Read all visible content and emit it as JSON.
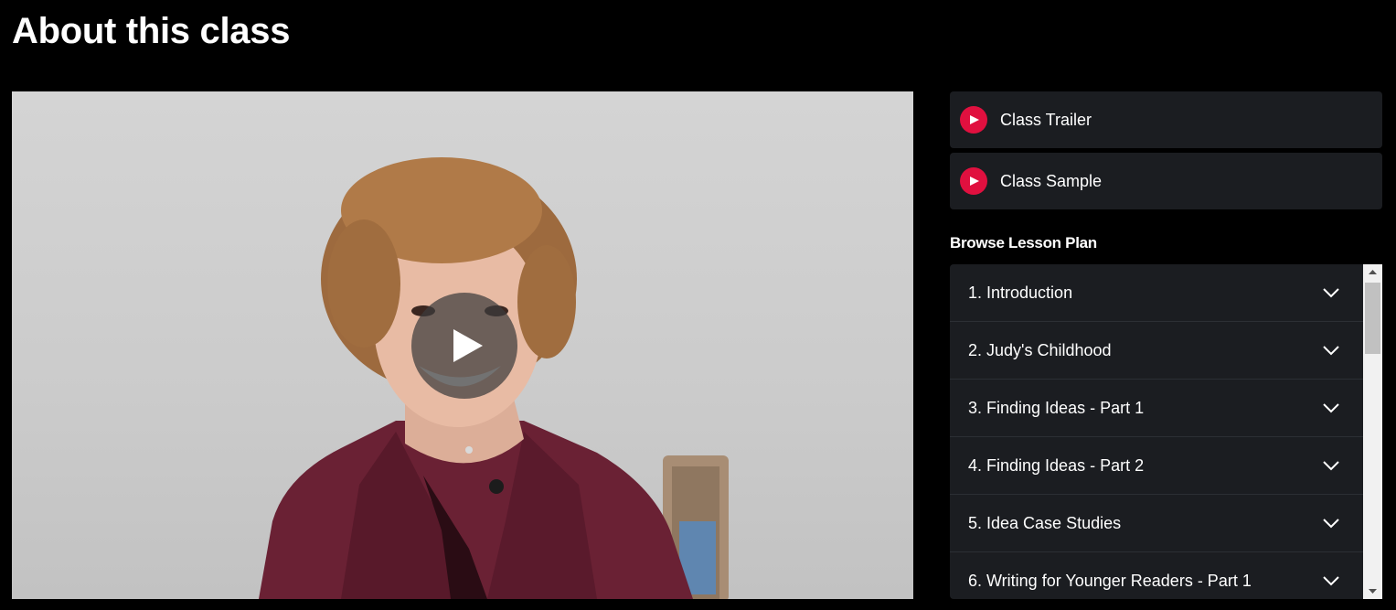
{
  "page": {
    "title": "About this class"
  },
  "video": {
    "poster_alt": "Instructor portrait",
    "play_icon": "play-icon"
  },
  "media": [
    {
      "label": "Class Trailer",
      "icon": "play-icon"
    },
    {
      "label": "Class Sample",
      "icon": "play-icon"
    }
  ],
  "lesson_plan": {
    "heading": "Browse Lesson Plan",
    "lessons": [
      {
        "title": "1. Introduction",
        "icon": "chevron-down-icon"
      },
      {
        "title": "2. Judy's Childhood",
        "icon": "chevron-down-icon"
      },
      {
        "title": "3. Finding Ideas - Part 1",
        "icon": "chevron-down-icon"
      },
      {
        "title": "4. Finding Ideas - Part 2",
        "icon": "chevron-down-icon"
      },
      {
        "title": "5. Idea Case Studies",
        "icon": "chevron-down-icon"
      },
      {
        "title": "6. Writing for Younger Readers - Part 1",
        "icon": "chevron-down-icon"
      }
    ]
  },
  "colors": {
    "background": "#000000",
    "card": "#1b1d21",
    "accent": "#e0103f",
    "text": "#ffffff"
  }
}
